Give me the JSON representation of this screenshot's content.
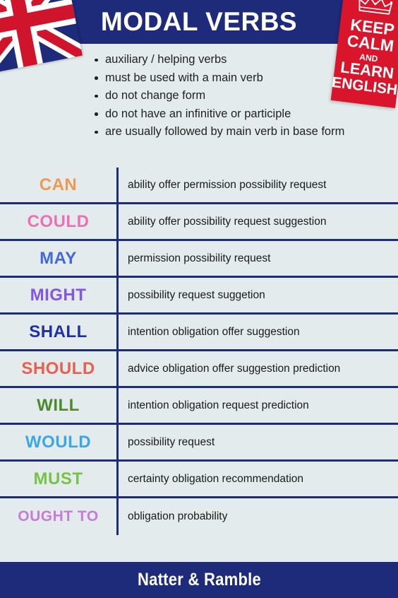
{
  "header": {
    "title": "MODAL VERBS",
    "flag_icon": "union-jack-flag"
  },
  "badge": {
    "crown_icon": "crown-icon",
    "line1": "KEEP",
    "line2": "CALM",
    "line3": "AND",
    "line4": "LEARN",
    "line5": "ENGLISH"
  },
  "intro": {
    "bullets": [
      "auxiliary / helping verbs",
      "must be used with a main verb",
      "do not change form",
      "do not have an infinitive or participle",
      "are usually followed by main verb in base form"
    ]
  },
  "table": {
    "rows": [
      {
        "modal": "CAN",
        "color": "#f0984f",
        "uses": "ability  offer  permission  possibility  request"
      },
      {
        "modal": "COULD",
        "color": "#ee6fb5",
        "uses": "ability  offer  possibility  request  suggestion"
      },
      {
        "modal": "MAY",
        "color": "#4169d8",
        "uses": "permission  possibility  request"
      },
      {
        "modal": "MIGHT",
        "color": "#8257e5",
        "uses": "possibility  request suggetion"
      },
      {
        "modal": "SHALL",
        "color": "#1f2fa8",
        "uses": "intention obligation  offer  suggestion"
      },
      {
        "modal": "SHOULD",
        "color": "#e8604f",
        "uses": "advice  obligation  offer  suggestion  prediction"
      },
      {
        "modal": "WILL",
        "color": "#4a8b2c",
        "uses": "intention obligation  request prediction"
      },
      {
        "modal": "WOULD",
        "color": "#3ba6e8",
        "uses": "possibility request"
      },
      {
        "modal": "MUST",
        "color": "#76c34a",
        "uses": "certainty  obligation recommendation"
      },
      {
        "modal": "OUGHT TO",
        "color": "#c87bd8",
        "uses": "obligation  probability"
      }
    ]
  },
  "footer": {
    "text": "Natter & Ramble"
  },
  "theme": {
    "navy": "#1e2a7a",
    "background": "#e4ebec",
    "badge_red": "#d8152a"
  }
}
